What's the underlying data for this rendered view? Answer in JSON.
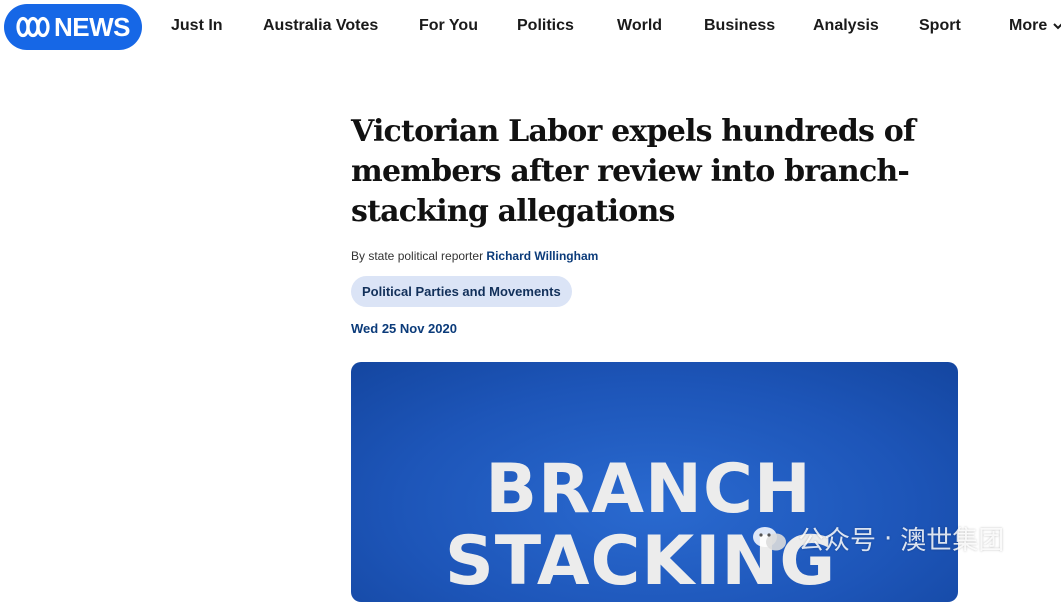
{
  "brand": {
    "logo_text": "NEWS",
    "logo_color": "#1667e6"
  },
  "nav": {
    "items": [
      {
        "label": "Just In"
      },
      {
        "label": "Australia Votes"
      },
      {
        "label": "For You"
      },
      {
        "label": "Politics"
      },
      {
        "label": "World"
      },
      {
        "label": "Business"
      },
      {
        "label": "Analysis"
      },
      {
        "label": "Sport"
      },
      {
        "label": "More"
      }
    ]
  },
  "article": {
    "headline": "Victorian Labor expels hundreds of members after review into branch-stacking allegations",
    "byline_prefix": "By state political reporter",
    "author": "Richard Willingham",
    "tag": "Political Parties and Movements",
    "date": "Wed 25 Nov 2020",
    "hero": {
      "line1": "BRANCH",
      "line2": "STACKING"
    }
  },
  "watermark": {
    "label": "公众号",
    "separator": "·",
    "org": "澳世集团"
  }
}
